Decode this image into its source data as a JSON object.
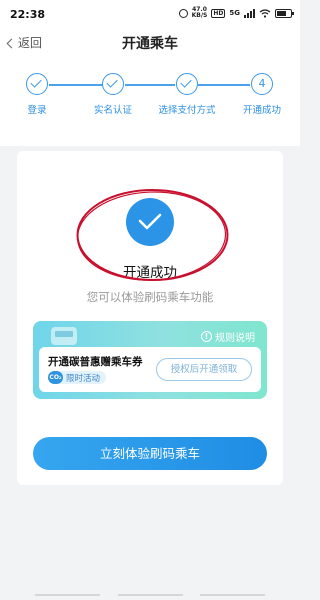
{
  "status_bar": {
    "time": "22:38",
    "speed_value": "47.0",
    "speed_unit": "KB/S",
    "network": "5G"
  },
  "nav": {
    "back_label": "返回",
    "title": "开通乘车"
  },
  "steps": [
    {
      "label": "登录",
      "state": "done",
      "number": ""
    },
    {
      "label": "实名认证",
      "state": "done",
      "number": ""
    },
    {
      "label": "选择支付方式",
      "state": "done",
      "number": ""
    },
    {
      "label": "开通成功",
      "state": "current",
      "number": "4"
    }
  ],
  "success": {
    "title": "开通成功",
    "subtitle": "您可以体验刷码乘车功能"
  },
  "promo": {
    "rules_label": "规则说明",
    "title": "开通碳普惠赠乘车券",
    "tag_icon": "CO₂",
    "tag_label": "限时活动",
    "auth_button": "授权后开通领取"
  },
  "primary_button": "立刻体验刷码乘车",
  "colors": {
    "accent": "#2b94e6",
    "annotation": "#c8102e",
    "page_bg": "#f2f3f5"
  }
}
